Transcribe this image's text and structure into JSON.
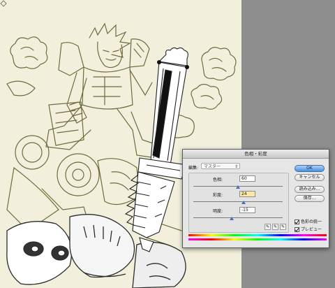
{
  "dialog": {
    "title": "色相・彩度",
    "edit_label": "編集:",
    "edit_value": "マスター",
    "sliders": [
      {
        "label": "色相:",
        "value": "60",
        "level": 0.5
      },
      {
        "label": "彩度:",
        "value": "24",
        "level": 0.56
      },
      {
        "label": "明度:",
        "value": "-15",
        "level": 0.43
      }
    ],
    "buttons": {
      "ok": "OK",
      "cancel": "キャンセル",
      "load": "読み込み...",
      "save": "保存..."
    },
    "checkboxes": {
      "colorize": "色彩の統一",
      "preview": "プレビュー"
    },
    "eyedropper_icons": [
      "eyedropper-icon",
      "eyedropper-plus-icon",
      "eyedropper-minus-icon"
    ]
  },
  "colors": {
    "canvas_background": "#f2f0dc",
    "sketch_line": "#6f6b3c",
    "workspace": "#8e8e8e",
    "ok_button": "#4d8fe0"
  }
}
